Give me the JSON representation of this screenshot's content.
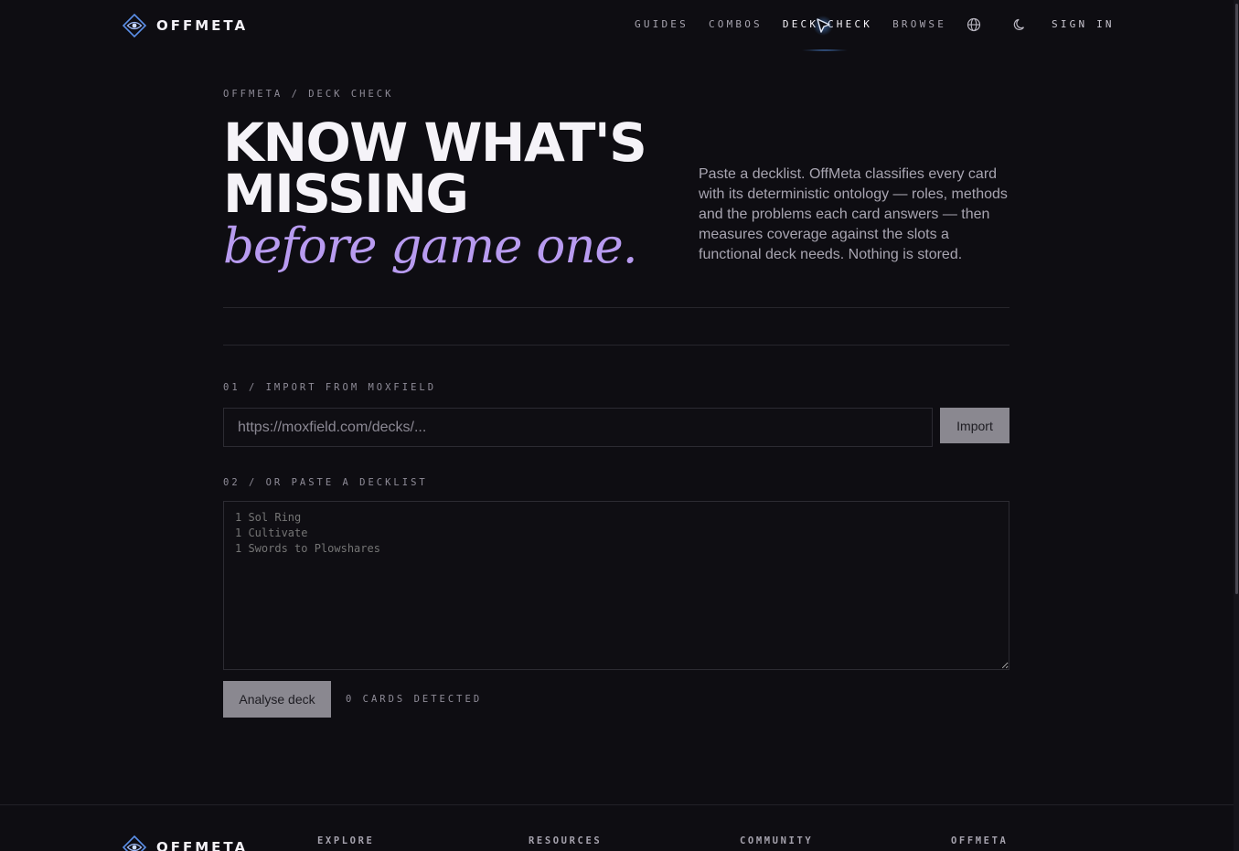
{
  "brand": {
    "name": "OFFMETA"
  },
  "nav": {
    "items": [
      {
        "label": "GUIDES"
      },
      {
        "label": "COMBOS"
      },
      {
        "label": "DECK CHECK",
        "active": true
      },
      {
        "label": "BROWSE"
      }
    ],
    "globe_icon": "globe-icon",
    "theme_icon": "moon-icon",
    "sign_in": "SIGN IN"
  },
  "hero": {
    "breadcrumb": "OFFMETA / DECK CHECK",
    "headline": "KNOW WHAT'S MISSING",
    "headline_italic": "before game one.",
    "intro": "Paste a decklist. OffMeta classifies every card with its deterministic ontology — roles, methods and the problems each card answers — then measures coverage against the slots a functional deck needs. Nothing is stored."
  },
  "import": {
    "label": "01 / IMPORT FROM MOXFIELD",
    "placeholder": "https://moxfield.com/decks/...",
    "value": "",
    "button": "Import"
  },
  "paste": {
    "label": "02 / OR PASTE A DECKLIST",
    "placeholder": "1 Sol Ring\n1 Cultivate\n1 Swords to Plowshares",
    "value": ""
  },
  "analyse": {
    "button": "Analyse deck",
    "status": "0 CARDS DETECTED"
  },
  "footer": {
    "brand": "OFFMETA",
    "columns": [
      {
        "title": "EXPLORE"
      },
      {
        "title": "RESOURCES"
      },
      {
        "title": "COMMUNITY"
      },
      {
        "title": "OFFMETA"
      }
    ]
  },
  "colors": {
    "background": "#0e0d12",
    "accent_italic": "#b89bf0",
    "logo_blue": "#5b8fe8",
    "button_bg": "#8a8890"
  }
}
